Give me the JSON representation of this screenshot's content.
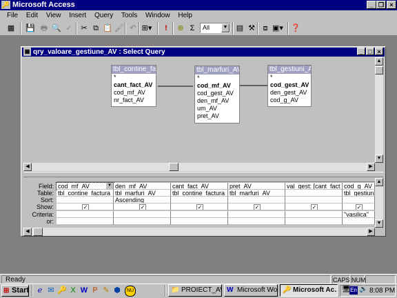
{
  "app": {
    "title": "Microsoft Access",
    "menu": [
      "File",
      "Edit",
      "View",
      "Insert",
      "Query",
      "Tools",
      "Window",
      "Help"
    ]
  },
  "toolbar": {
    "combo_value": "All"
  },
  "query_window": {
    "title": "qry_valoare_gestiune_AV : Select Query"
  },
  "tables": [
    {
      "name": "tbl_contine_factu",
      "fields": [
        {
          "label": "*",
          "key": false
        },
        {
          "label": "cant_fact_AV",
          "key": true
        },
        {
          "label": "cod_mf_AV",
          "key": false
        },
        {
          "label": "nr_fact_AV",
          "key": false
        }
      ]
    },
    {
      "name": "tbl_marfuri_AV",
      "fields": [
        {
          "label": "*",
          "key": false
        },
        {
          "label": "cod_mf_AV",
          "key": true
        },
        {
          "label": "cod_gest_AV",
          "key": false
        },
        {
          "label": "den_mf_AV",
          "key": false
        },
        {
          "label": "um_AV",
          "key": false
        },
        {
          "label": "pret_AV",
          "key": false
        }
      ]
    },
    {
      "name": "tbl_gestiuni_AV",
      "fields": [
        {
          "label": "*",
          "key": false
        },
        {
          "label": "cod_gest_AV",
          "key": true
        },
        {
          "label": "den_gest_AV",
          "key": false
        },
        {
          "label": "cod_g_AV",
          "key": false
        }
      ]
    }
  ],
  "grid": {
    "row_labels": [
      "Field:",
      "Table:",
      "Sort:",
      "Show:",
      "Criteria:",
      "or:"
    ],
    "columns": [
      {
        "field": "cod_mf_AV",
        "table": "tbl_contine_factura",
        "sort": "",
        "show": true,
        "criteria": ""
      },
      {
        "field": "den_mf_AV",
        "table": "tbl_marfuri_AV",
        "sort": "Ascending",
        "show": true,
        "criteria": ""
      },
      {
        "field": "cant_fact_AV",
        "table": "tbl_contine_factura",
        "sort": "",
        "show": true,
        "criteria": ""
      },
      {
        "field": "pret_AV",
        "table": "tbl_marfuri_AV",
        "sort": "",
        "show": true,
        "criteria": ""
      },
      {
        "field": "val_gest: [cant_fact",
        "table": "",
        "sort": "",
        "show": true,
        "criteria": ""
      },
      {
        "field": "cod_g_AV",
        "table": "tbl_gestiuni_A",
        "sort": "",
        "show": true,
        "criteria": "\"vasilica\""
      }
    ]
  },
  "status": {
    "text": "Ready",
    "caps": "CAPS",
    "num": "NUM"
  },
  "taskbar": {
    "start": "Start",
    "tasks": [
      "PROIECT_AV",
      "Microsoft Word ...",
      "Microsoft Ac..."
    ],
    "lang": "En",
    "clock": "8:08 PM"
  }
}
